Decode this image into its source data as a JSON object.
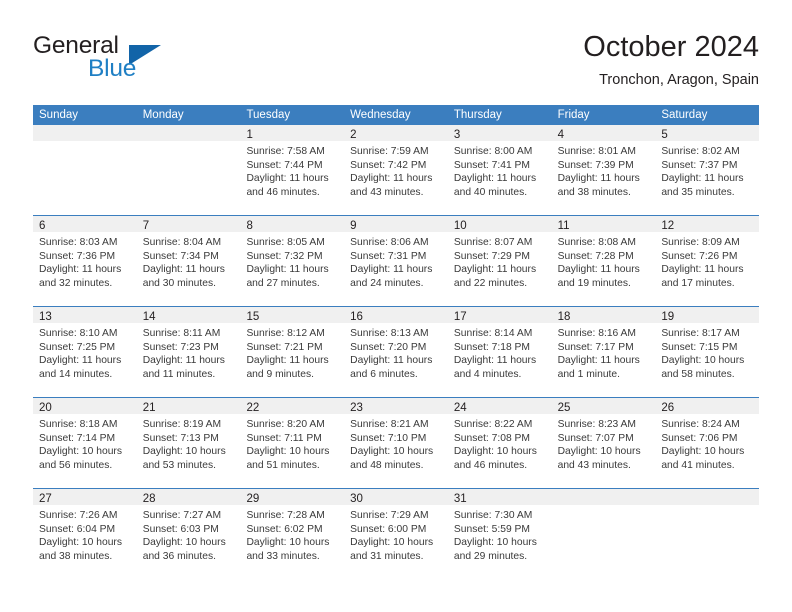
{
  "brand": {
    "name_part1": "General",
    "name_part2": "Blue",
    "accent_color": "#1264a8",
    "text_color": "#231f20"
  },
  "header": {
    "month_title": "October 2024",
    "location": "Tronchon, Aragon, Spain"
  },
  "calendar": {
    "header_bg": "#3b7ebf",
    "day_band_bg": "#f0f0f0",
    "weekday_headers": [
      "Sunday",
      "Monday",
      "Tuesday",
      "Wednesday",
      "Thursday",
      "Friday",
      "Saturday"
    ],
    "weeks": [
      [
        {
          "day": "",
          "lines": []
        },
        {
          "day": "",
          "lines": []
        },
        {
          "day": "1",
          "lines": [
            "Sunrise: 7:58 AM",
            "Sunset: 7:44 PM",
            "Daylight: 11 hours",
            "and 46 minutes."
          ]
        },
        {
          "day": "2",
          "lines": [
            "Sunrise: 7:59 AM",
            "Sunset: 7:42 PM",
            "Daylight: 11 hours",
            "and 43 minutes."
          ]
        },
        {
          "day": "3",
          "lines": [
            "Sunrise: 8:00 AM",
            "Sunset: 7:41 PM",
            "Daylight: 11 hours",
            "and 40 minutes."
          ]
        },
        {
          "day": "4",
          "lines": [
            "Sunrise: 8:01 AM",
            "Sunset: 7:39 PM",
            "Daylight: 11 hours",
            "and 38 minutes."
          ]
        },
        {
          "day": "5",
          "lines": [
            "Sunrise: 8:02 AM",
            "Sunset: 7:37 PM",
            "Daylight: 11 hours",
            "and 35 minutes."
          ]
        }
      ],
      [
        {
          "day": "6",
          "lines": [
            "Sunrise: 8:03 AM",
            "Sunset: 7:36 PM",
            "Daylight: 11 hours",
            "and 32 minutes."
          ]
        },
        {
          "day": "7",
          "lines": [
            "Sunrise: 8:04 AM",
            "Sunset: 7:34 PM",
            "Daylight: 11 hours",
            "and 30 minutes."
          ]
        },
        {
          "day": "8",
          "lines": [
            "Sunrise: 8:05 AM",
            "Sunset: 7:32 PM",
            "Daylight: 11 hours",
            "and 27 minutes."
          ]
        },
        {
          "day": "9",
          "lines": [
            "Sunrise: 8:06 AM",
            "Sunset: 7:31 PM",
            "Daylight: 11 hours",
            "and 24 minutes."
          ]
        },
        {
          "day": "10",
          "lines": [
            "Sunrise: 8:07 AM",
            "Sunset: 7:29 PM",
            "Daylight: 11 hours",
            "and 22 minutes."
          ]
        },
        {
          "day": "11",
          "lines": [
            "Sunrise: 8:08 AM",
            "Sunset: 7:28 PM",
            "Daylight: 11 hours",
            "and 19 minutes."
          ]
        },
        {
          "day": "12",
          "lines": [
            "Sunrise: 8:09 AM",
            "Sunset: 7:26 PM",
            "Daylight: 11 hours",
            "and 17 minutes."
          ]
        }
      ],
      [
        {
          "day": "13",
          "lines": [
            "Sunrise: 8:10 AM",
            "Sunset: 7:25 PM",
            "Daylight: 11 hours",
            "and 14 minutes."
          ]
        },
        {
          "day": "14",
          "lines": [
            "Sunrise: 8:11 AM",
            "Sunset: 7:23 PM",
            "Daylight: 11 hours",
            "and 11 minutes."
          ]
        },
        {
          "day": "15",
          "lines": [
            "Sunrise: 8:12 AM",
            "Sunset: 7:21 PM",
            "Daylight: 11 hours",
            "and 9 minutes."
          ]
        },
        {
          "day": "16",
          "lines": [
            "Sunrise: 8:13 AM",
            "Sunset: 7:20 PM",
            "Daylight: 11 hours",
            "and 6 minutes."
          ]
        },
        {
          "day": "17",
          "lines": [
            "Sunrise: 8:14 AM",
            "Sunset: 7:18 PM",
            "Daylight: 11 hours",
            "and 4 minutes."
          ]
        },
        {
          "day": "18",
          "lines": [
            "Sunrise: 8:16 AM",
            "Sunset: 7:17 PM",
            "Daylight: 11 hours",
            "and 1 minute."
          ]
        },
        {
          "day": "19",
          "lines": [
            "Sunrise: 8:17 AM",
            "Sunset: 7:15 PM",
            "Daylight: 10 hours",
            "and 58 minutes."
          ]
        }
      ],
      [
        {
          "day": "20",
          "lines": [
            "Sunrise: 8:18 AM",
            "Sunset: 7:14 PM",
            "Daylight: 10 hours",
            "and 56 minutes."
          ]
        },
        {
          "day": "21",
          "lines": [
            "Sunrise: 8:19 AM",
            "Sunset: 7:13 PM",
            "Daylight: 10 hours",
            "and 53 minutes."
          ]
        },
        {
          "day": "22",
          "lines": [
            "Sunrise: 8:20 AM",
            "Sunset: 7:11 PM",
            "Daylight: 10 hours",
            "and 51 minutes."
          ]
        },
        {
          "day": "23",
          "lines": [
            "Sunrise: 8:21 AM",
            "Sunset: 7:10 PM",
            "Daylight: 10 hours",
            "and 48 minutes."
          ]
        },
        {
          "day": "24",
          "lines": [
            "Sunrise: 8:22 AM",
            "Sunset: 7:08 PM",
            "Daylight: 10 hours",
            "and 46 minutes."
          ]
        },
        {
          "day": "25",
          "lines": [
            "Sunrise: 8:23 AM",
            "Sunset: 7:07 PM",
            "Daylight: 10 hours",
            "and 43 minutes."
          ]
        },
        {
          "day": "26",
          "lines": [
            "Sunrise: 8:24 AM",
            "Sunset: 7:06 PM",
            "Daylight: 10 hours",
            "and 41 minutes."
          ]
        }
      ],
      [
        {
          "day": "27",
          "lines": [
            "Sunrise: 7:26 AM",
            "Sunset: 6:04 PM",
            "Daylight: 10 hours",
            "and 38 minutes."
          ]
        },
        {
          "day": "28",
          "lines": [
            "Sunrise: 7:27 AM",
            "Sunset: 6:03 PM",
            "Daylight: 10 hours",
            "and 36 minutes."
          ]
        },
        {
          "day": "29",
          "lines": [
            "Sunrise: 7:28 AM",
            "Sunset: 6:02 PM",
            "Daylight: 10 hours",
            "and 33 minutes."
          ]
        },
        {
          "day": "30",
          "lines": [
            "Sunrise: 7:29 AM",
            "Sunset: 6:00 PM",
            "Daylight: 10 hours",
            "and 31 minutes."
          ]
        },
        {
          "day": "31",
          "lines": [
            "Sunrise: 7:30 AM",
            "Sunset: 5:59 PM",
            "Daylight: 10 hours",
            "and 29 minutes."
          ]
        },
        {
          "day": "",
          "lines": []
        },
        {
          "day": "",
          "lines": []
        }
      ]
    ]
  }
}
